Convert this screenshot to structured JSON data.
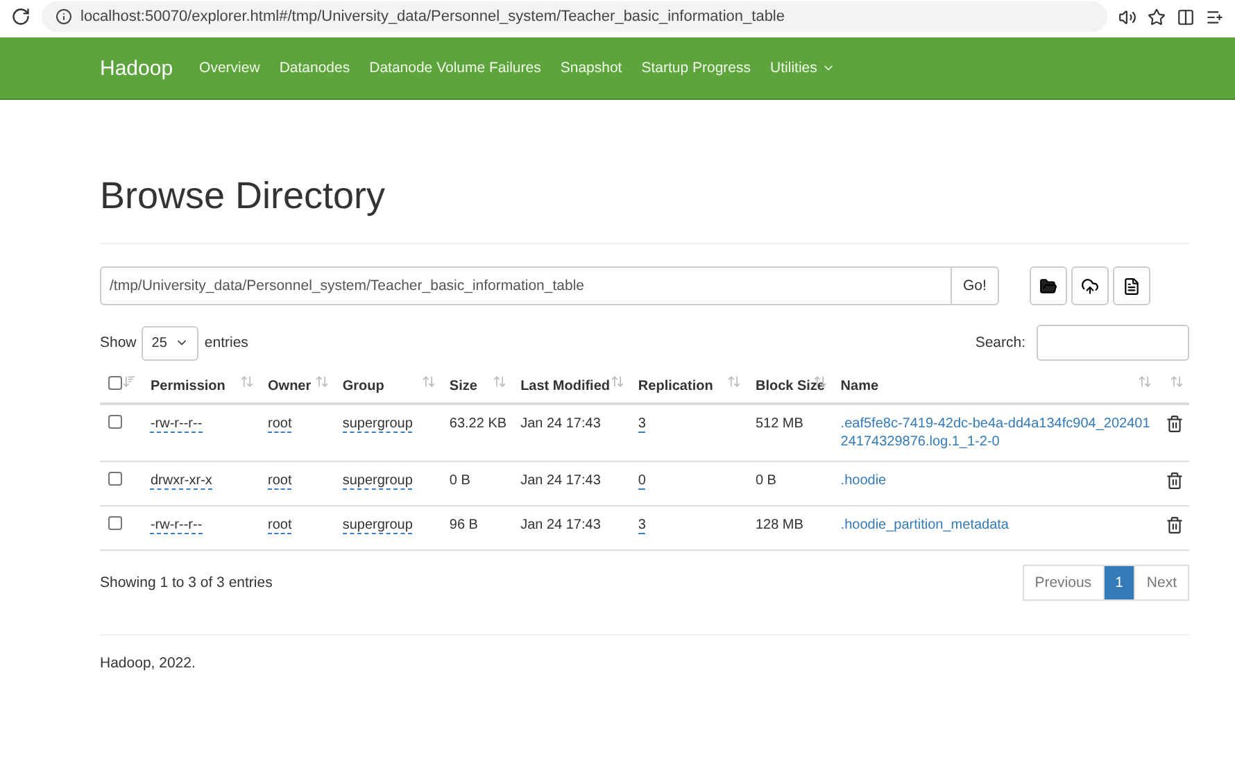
{
  "browser": {
    "url": "localhost:50070/explorer.html#/tmp/University_data/Personnel_system/Teacher_basic_information_table"
  },
  "navbar": {
    "brand": "Hadoop",
    "items": [
      {
        "label": "Overview",
        "dropdown": false
      },
      {
        "label": "Datanodes",
        "dropdown": false
      },
      {
        "label": "Datanode Volume Failures",
        "dropdown": false
      },
      {
        "label": "Snapshot",
        "dropdown": false
      },
      {
        "label": "Startup Progress",
        "dropdown": false
      },
      {
        "label": "Utilities",
        "dropdown": true
      }
    ]
  },
  "title": "Browse Directory",
  "path": {
    "value": "/tmp/University_data/Personnel_system/Teacher_basic_information_table",
    "button": "Go!"
  },
  "length": {
    "label_before": "Show",
    "value": "25",
    "label_after": "entries"
  },
  "search": {
    "label": "Search:"
  },
  "table": {
    "select_all": false,
    "columns": [
      "Permission",
      "Owner",
      "Group",
      "Size",
      "Last Modified",
      "Replication",
      "Block Size",
      "Name"
    ],
    "rows": [
      {
        "checked": false,
        "permission": "-rw-r--r--",
        "owner": "root",
        "group": "supergroup",
        "size": "63.22 KB",
        "modified": "Jan 24 17:43",
        "replication": "3",
        "block_size": "512 MB",
        "name": ".eaf5fe8c-7419-42dc-be4a-dd4a134fc904_20240124174329876.log.1_1-2-0"
      },
      {
        "checked": false,
        "permission": "drwxr-xr-x",
        "owner": "root",
        "group": "supergroup",
        "size": "0 B",
        "modified": "Jan 24 17:43",
        "replication": "0",
        "block_size": "0 B",
        "name": ".hoodie"
      },
      {
        "checked": false,
        "permission": "-rw-r--r--",
        "owner": "root",
        "group": "supergroup",
        "size": "96 B",
        "modified": "Jan 24 17:43",
        "replication": "3",
        "block_size": "128 MB",
        "name": ".hoodie_partition_metadata"
      }
    ]
  },
  "info": "Showing 1 to 3 of 3 entries",
  "pagination": [
    {
      "label": "Previous",
      "selected": false
    },
    {
      "label": "1",
      "selected": true
    },
    {
      "label": "Next",
      "selected": false
    }
  ],
  "footer": "Hadoop, 2022."
}
